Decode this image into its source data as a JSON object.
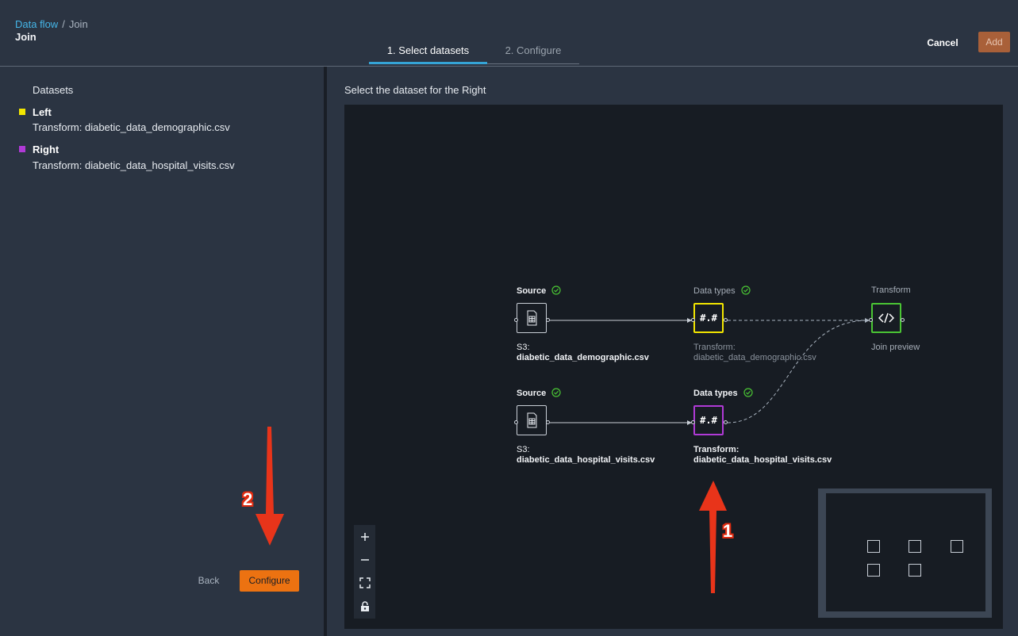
{
  "breadcrumb": {
    "root": "Data flow",
    "separator": "/",
    "current": "Join"
  },
  "page_title": "Join",
  "tabs": [
    {
      "label": "1. Select datasets",
      "active": true
    },
    {
      "label": "2. Configure",
      "active": false
    }
  ],
  "header_actions": {
    "cancel": "Cancel",
    "add": "Add"
  },
  "datasets": {
    "heading": "Datasets",
    "items": [
      {
        "name": "Left",
        "detail": "Transform: diabetic_data_demographic.csv",
        "color": "#f3e600"
      },
      {
        "name": "Right",
        "detail": "Transform: diabetic_data_hospital_visits.csv",
        "color": "#b03ad6"
      }
    ]
  },
  "footer": {
    "back": "Back",
    "configure": "Configure"
  },
  "canvas": {
    "instruction": "Select the dataset for the Right",
    "nodes": {
      "source1": {
        "label": "Source",
        "caption_line1": "S3:",
        "caption_line2": "diabetic_data_demographic.csv",
        "icon": "file-table-icon"
      },
      "dtypes1": {
        "label": "Data types",
        "symbol": "#.#",
        "caption_line1": "Transform:",
        "caption_line2": "diabetic_data_demographic.csv",
        "highlight": "#f3e600"
      },
      "transform": {
        "label": "Transform",
        "caption": "Join preview",
        "icon": "code-icon",
        "highlight": "#4ac534"
      },
      "source2": {
        "label": "Source",
        "caption_line1": "S3:",
        "caption_line2": "diabetic_data_hospital_visits.csv",
        "icon": "file-table-icon"
      },
      "dtypes2": {
        "label": "Data types",
        "symbol": "#.#",
        "caption_line1": "Transform:",
        "caption_line2": "diabetic_data_hospital_visits.csv",
        "highlight": "#b03ad6"
      }
    },
    "zoom_controls": [
      "zoom-in-icon",
      "zoom-out-icon",
      "fit-view-icon",
      "lock-icon"
    ]
  },
  "annotations": {
    "arrow1": "1",
    "arrow2": "2",
    "color": "#e02b10"
  }
}
